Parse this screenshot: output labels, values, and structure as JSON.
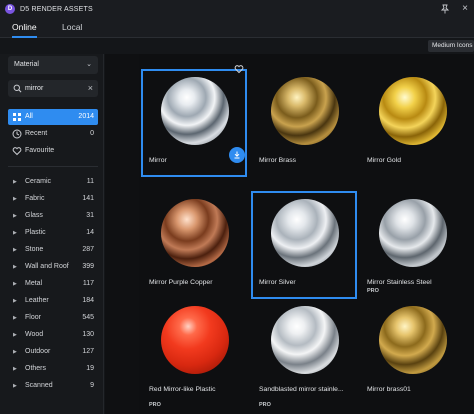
{
  "window": {
    "title": "D5 RENDER ASSETS"
  },
  "tabs": [
    {
      "label": "Online",
      "active": true
    },
    {
      "label": "Local",
      "active": false
    }
  ],
  "toolbar": {
    "view_label": "Medium Icons"
  },
  "filter": {
    "type_value": "Material",
    "search_value": "mirror"
  },
  "quick_filters": [
    {
      "label": "All",
      "count": "2014",
      "icon": "grid-icon",
      "active": true
    },
    {
      "label": "Recent",
      "count": "0",
      "icon": "clock-icon",
      "active": false
    },
    {
      "label": "Favourite",
      "count": "",
      "icon": "heart-icon",
      "active": false
    }
  ],
  "categories": [
    {
      "label": "Ceramic",
      "count": "11"
    },
    {
      "label": "Fabric",
      "count": "141"
    },
    {
      "label": "Glass",
      "count": "31"
    },
    {
      "label": "Plastic",
      "count": "14"
    },
    {
      "label": "Stone",
      "count": "287"
    },
    {
      "label": "Wall and Roof",
      "count": "399"
    },
    {
      "label": "Metal",
      "count": "117"
    },
    {
      "label": "Leather",
      "count": "184"
    },
    {
      "label": "Floor",
      "count": "545"
    },
    {
      "label": "Wood",
      "count": "130"
    },
    {
      "label": "Outdoor",
      "count": "127"
    },
    {
      "label": "Others",
      "count": "19"
    },
    {
      "label": "Scanned",
      "count": "9"
    }
  ],
  "assets": [
    {
      "name": "Mirror",
      "material": "chrome",
      "selected": true,
      "pro": false
    },
    {
      "name": "Mirror Brass",
      "material": "brass",
      "selected": false,
      "pro": false
    },
    {
      "name": "Mirror Gold",
      "material": "gold",
      "selected": false,
      "pro": false
    },
    {
      "name": "Mirror Purple Copper",
      "material": "copper",
      "selected": false,
      "pro": false
    },
    {
      "name": "Mirror Silver",
      "material": "silver",
      "selected": true,
      "pro": false
    },
    {
      "name": "Mirror Stainless Steel",
      "material": "steel",
      "selected": false,
      "pro": true
    },
    {
      "name": "Red Mirror-like Plastic",
      "material": "red",
      "selected": false,
      "pro": true
    },
    {
      "name": "Sandblasted mirror stainle...",
      "material": "sandblasted",
      "selected": false,
      "pro": true
    },
    {
      "name": "Mirror brass01",
      "material": "brass01",
      "selected": false,
      "pro": false
    }
  ],
  "badges": {
    "pro_label": "PRO"
  },
  "colors": {
    "accent": "#2f8cf0",
    "background": "#141619",
    "brand": "#7a55e0"
  }
}
